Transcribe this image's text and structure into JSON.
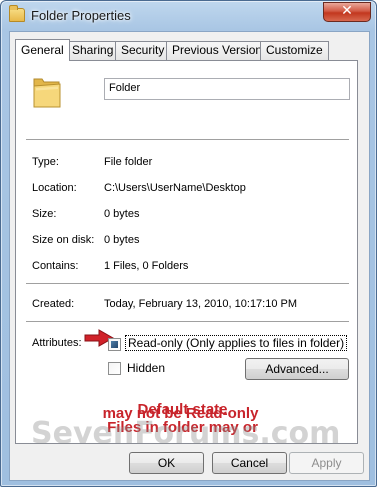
{
  "window": {
    "title": "Folder Properties",
    "close_symbol": "✕"
  },
  "tabs": [
    {
      "label": "General",
      "active": true
    },
    {
      "label": "Sharing",
      "active": false
    },
    {
      "label": "Security",
      "active": false
    },
    {
      "label": "Previous Versions",
      "active": false
    },
    {
      "label": "Customize",
      "active": false
    }
  ],
  "general": {
    "name_value": "Folder",
    "properties": [
      {
        "label": "Type:",
        "value": "File folder"
      },
      {
        "label": "Location:",
        "value": "C:\\Users\\UserName\\Desktop"
      },
      {
        "label": "Size:",
        "value": "0 bytes"
      },
      {
        "label": "Size on disk:",
        "value": "0 bytes"
      },
      {
        "label": "Contains:",
        "value": "1 Files, 0 Folders"
      },
      {
        "label": "Created:",
        "value": "Today, February 13, 2010, 10:17:10 PM"
      }
    ],
    "attributes_label": "Attributes:",
    "readonly_label": "Read-only (Only applies to files in folder)",
    "readonly_state": "indeterminate",
    "hidden_label": "Hidden",
    "hidden_checked": false,
    "advanced_button": "Advanced..."
  },
  "annotation": {
    "line1": "Default state",
    "line2": "Files in folder may or",
    "line3": "may not be Read-only",
    "color": "#c8242b"
  },
  "watermark": "SevenForums.com",
  "buttons": {
    "ok": "OK",
    "cancel": "Cancel",
    "apply": "Apply"
  },
  "colors": {
    "panel_bg": "#ffffff",
    "dialog_bg": "#f0f0f0",
    "frame": "#a9c6e4"
  }
}
